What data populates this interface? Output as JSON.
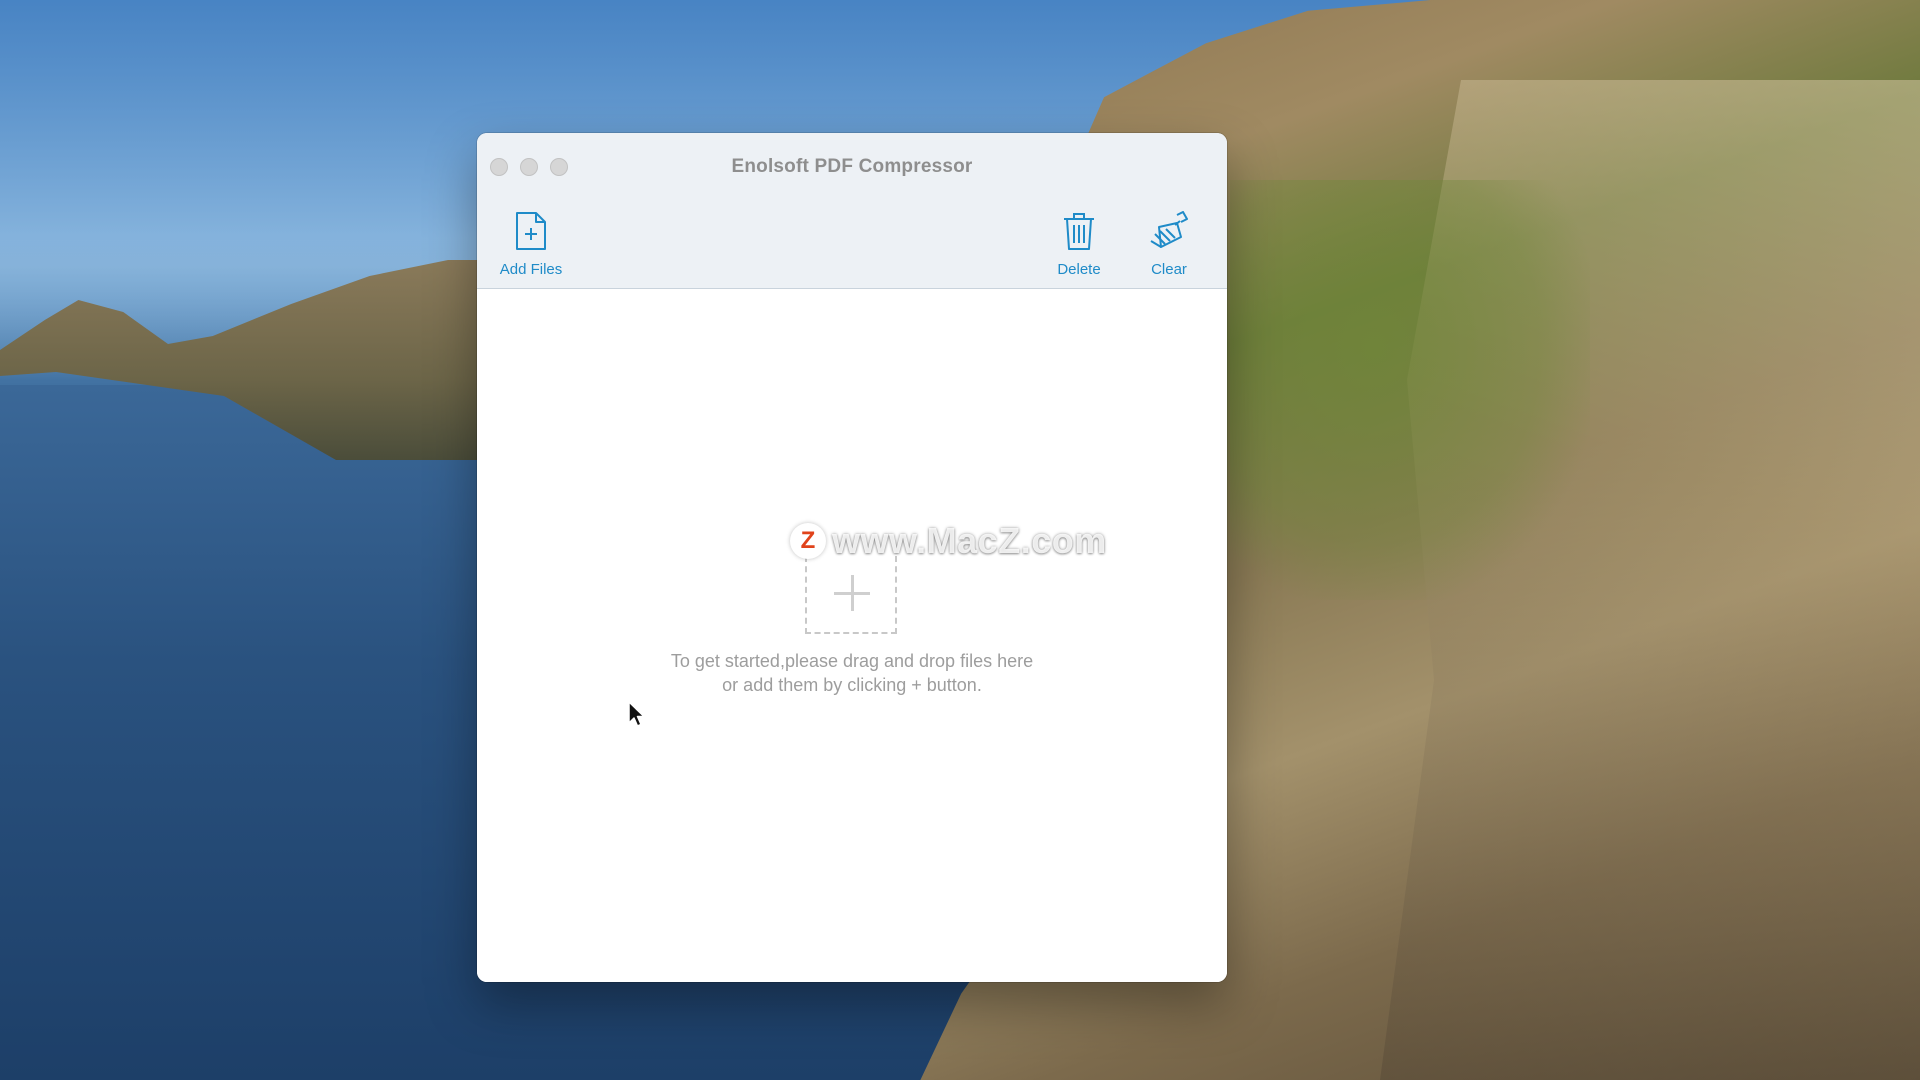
{
  "window": {
    "title": "Enolsoft PDF Compressor"
  },
  "toolbar": {
    "add_files_label": "Add Files",
    "delete_label": "Delete",
    "clear_label": "Clear"
  },
  "drop_area": {
    "line1": "To get started,please drag and drop files here",
    "line2": "or add them by clicking + button."
  },
  "watermark": {
    "logo_letter": "Z",
    "text": "www.MacZ.com"
  },
  "colors": {
    "accent": "#1f8bc8",
    "hint_text": "#9d9d9d",
    "toolbar_bg": "#edf1f5"
  },
  "icons": {
    "add_files": "document-plus-icon",
    "delete": "trash-icon",
    "clear": "broom-icon",
    "drop": "plus-icon"
  }
}
